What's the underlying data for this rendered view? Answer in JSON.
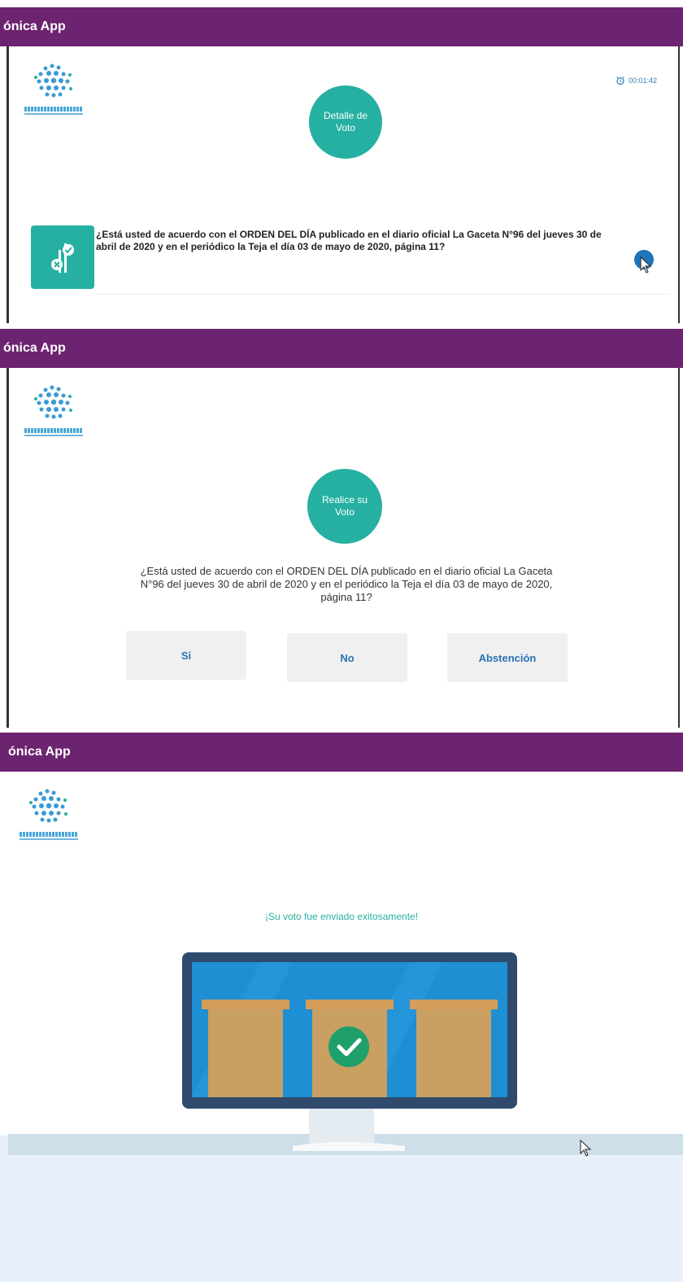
{
  "app": {
    "title": "ónica App"
  },
  "screen1": {
    "badge_label": "Detalle de Voto",
    "timer": "00:01:42",
    "question": "¿Está usted de acuerdo con el ORDEN DEL DÍA publicado en el diario oficial La Gaceta N°96 del jueves 30 de abril de 2020 y en el periódico la Teja el día 03 de mayo de 2020, página 11?",
    "icons": {
      "vote": "vote-ballot-icon",
      "timer": "alarm-clock-icon",
      "action": "next-arrow-icon"
    }
  },
  "screen2": {
    "badge_label": "Realice su Voto",
    "question": "¿Está usted de acuerdo con el ORDEN DEL DÍA publicado en el diario oficial La Gaceta N°96 del jueves 30 de abril de 2020 y en el periódico la Teja el día 03 de mayo de 2020, página 11?",
    "buttons": {
      "yes": "Si",
      "no": "No",
      "abstain": "Abstención"
    }
  },
  "screen3": {
    "title": "ónica App",
    "message": "¡Su voto fue enviado exitosamente!"
  },
  "colors": {
    "header": "#6d2470",
    "accent": "#26b0a1",
    "link": "#2773b5"
  }
}
